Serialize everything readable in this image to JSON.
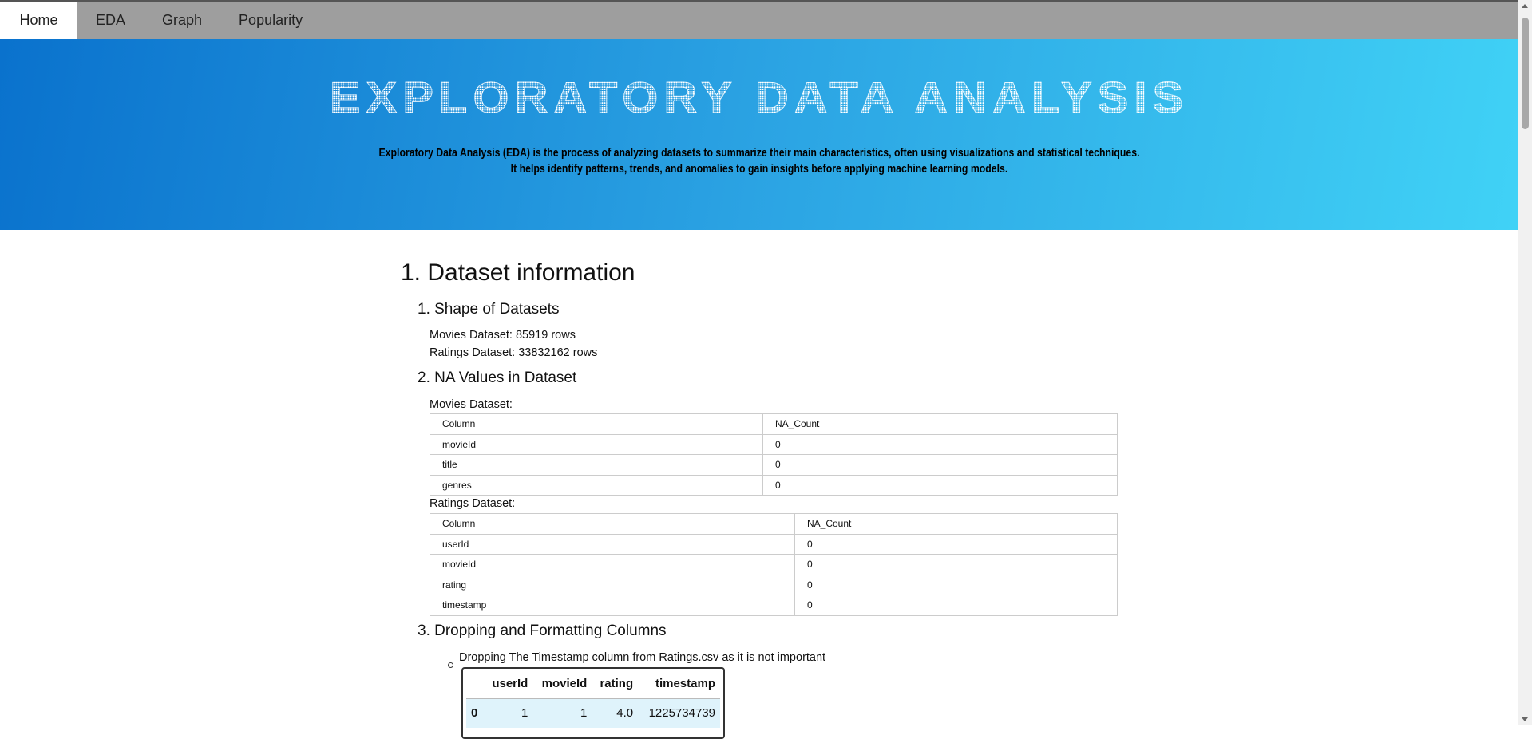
{
  "nav": {
    "tabs": [
      {
        "label": "Home",
        "active": true
      },
      {
        "label": "EDA"
      },
      {
        "label": "Graph"
      },
      {
        "label": "Popularity"
      }
    ]
  },
  "hero": {
    "title": "EXPLORATORY DATA ANALYSIS",
    "line1": "Exploratory Data Analysis (EDA) is the process of analyzing datasets to summarize their main characteristics, often using visualizations and statistical techniques.",
    "line2": "It helps identify patterns, trends, and anomalies to gain insights before applying machine learning models."
  },
  "section1": {
    "title": "1. Dataset information",
    "shape": {
      "title": "1. Shape of Datasets",
      "movies": "Movies Dataset: 85919 rows",
      "ratings": "Ratings Dataset: 33832162 rows"
    },
    "na": {
      "title": "2. NA Values in Dataset",
      "movies_label": "Movies Dataset:",
      "movies_table": [
        [
          "Column",
          "NA_Count"
        ],
        [
          "movieId",
          "0"
        ],
        [
          "title",
          "0"
        ],
        [
          "genres",
          "0"
        ]
      ],
      "ratings_label": "Ratings Dataset:",
      "ratings_table": [
        [
          "Column",
          "NA_Count"
        ],
        [
          "userId",
          "0"
        ],
        [
          "movieId",
          "0"
        ],
        [
          "rating",
          "0"
        ],
        [
          "timestamp",
          "0"
        ]
      ]
    },
    "drop": {
      "title": "3. Dropping and Formatting Columns",
      "bullet": "Dropping The Timestamp column from Ratings.csv as it is not important",
      "df_headers": [
        "",
        "userId",
        "movieId",
        "rating",
        "timestamp"
      ],
      "df_rows": [
        [
          "0",
          "1",
          "1",
          "4.0",
          "1225734739"
        ]
      ]
    }
  }
}
